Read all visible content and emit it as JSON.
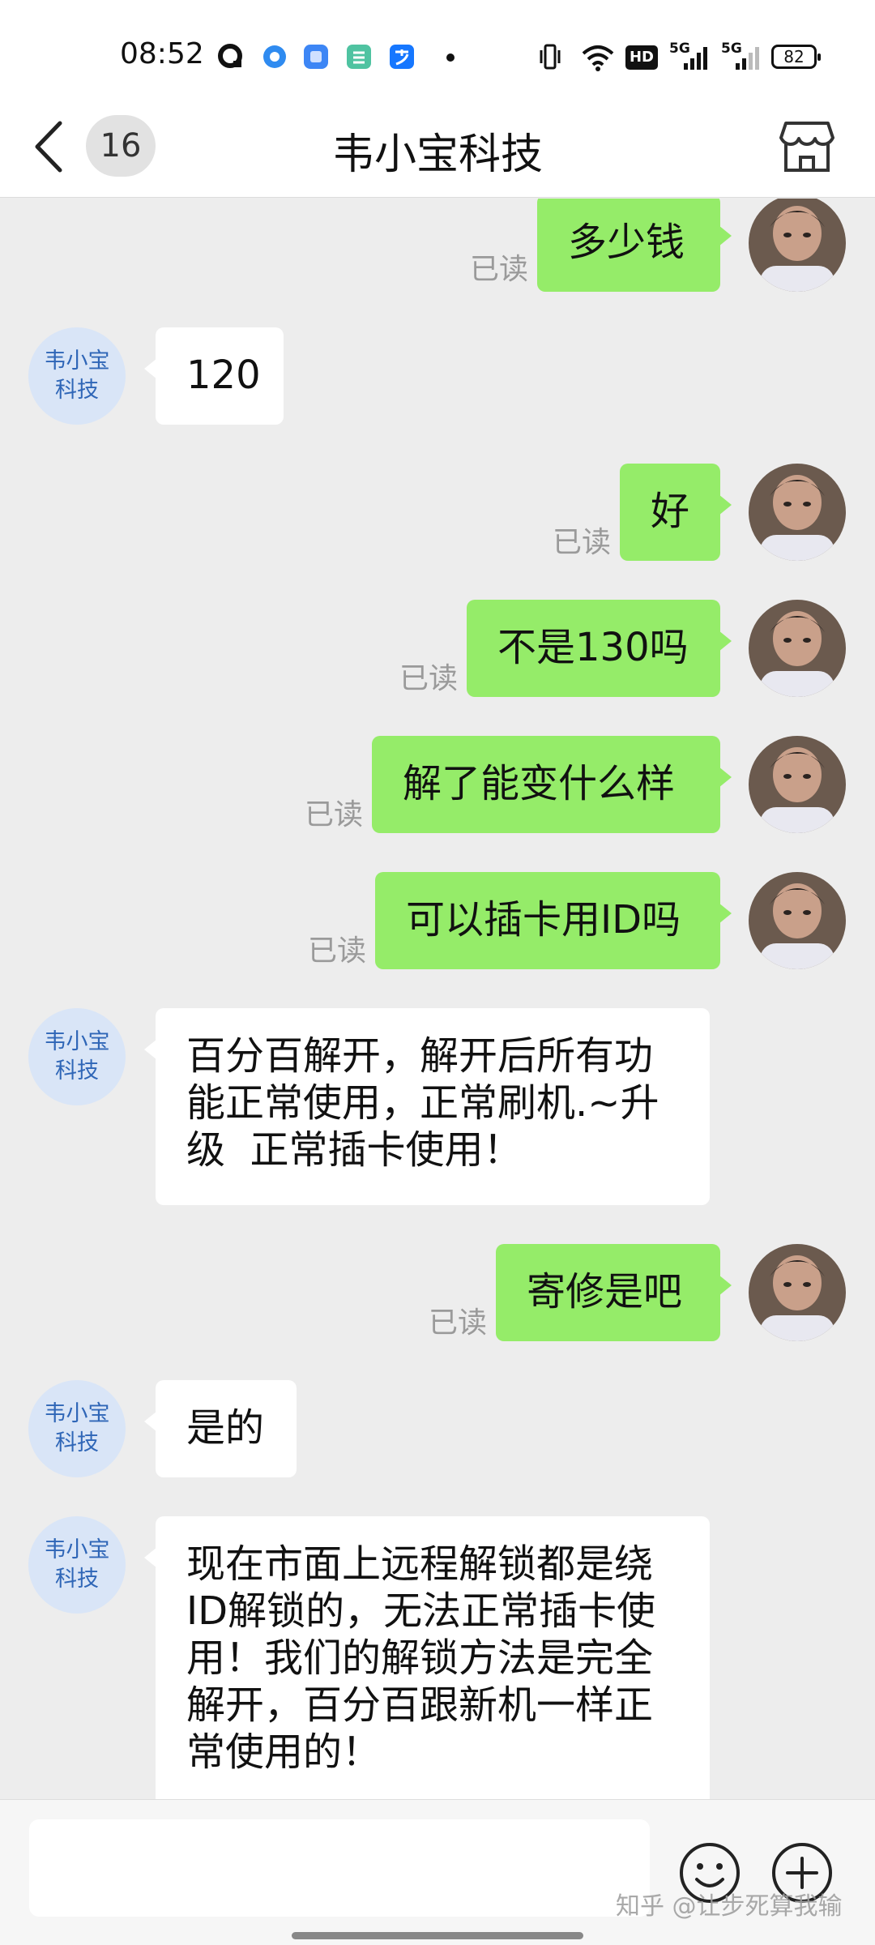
{
  "status_bar": {
    "time": "08:52",
    "battery": "82",
    "hd_label": "HD",
    "signal1_label": "5G",
    "signal2_label": "5G",
    "icons": [
      "q-app-icon",
      "circle-app-icon",
      "square-app-icon",
      "green-app-icon",
      "alipay-icon",
      "vibrate-icon",
      "wifi-icon",
      "hd-icon",
      "signal-icon",
      "signal-icon",
      "battery-icon"
    ]
  },
  "header": {
    "back_icon": "chevron-left-icon",
    "unread_count": "16",
    "title": "韦小宝科技",
    "store_icon": "store-icon"
  },
  "contact_avatar_text": "韦小宝\n科技",
  "messages": [
    {
      "from": "me",
      "text": "多少钱",
      "status": "已读"
    },
    {
      "from": "them",
      "text": "120"
    },
    {
      "from": "me",
      "text": "好",
      "status": "已读"
    },
    {
      "from": "me",
      "text": "不是130吗",
      "status": "已读"
    },
    {
      "from": "me",
      "text": "解了能变什么样",
      "status": "已读"
    },
    {
      "from": "me",
      "text": "可以插卡用ID吗",
      "status": "已读"
    },
    {
      "from": "them",
      "text": "百分百解开，解开后所有功\n能正常使用，正常刷机.~升\n级  正常插卡使用！"
    },
    {
      "from": "me",
      "text": "寄修是吧",
      "status": "已读"
    },
    {
      "from": "them",
      "text": "是的"
    },
    {
      "from": "them",
      "text": "现在市面上远程解锁都是绕\nID解锁的，无法正常插卡使\n用！我们的解锁方法是完全\n解开，百分百跟新机一样正\n常使用的！"
    }
  ],
  "input_bar": {
    "input_value": "",
    "emoji_icon": "smiley-icon",
    "plus_icon": "plus-circle-icon"
  },
  "watermark": "知乎 @让步死算我输",
  "colors": {
    "background": "#ededed",
    "my_bubble": "#95ec69",
    "their_bubble": "#ffffff",
    "avatar_bg": "#d9e5f7",
    "avatar_text": "#2f66b7"
  }
}
